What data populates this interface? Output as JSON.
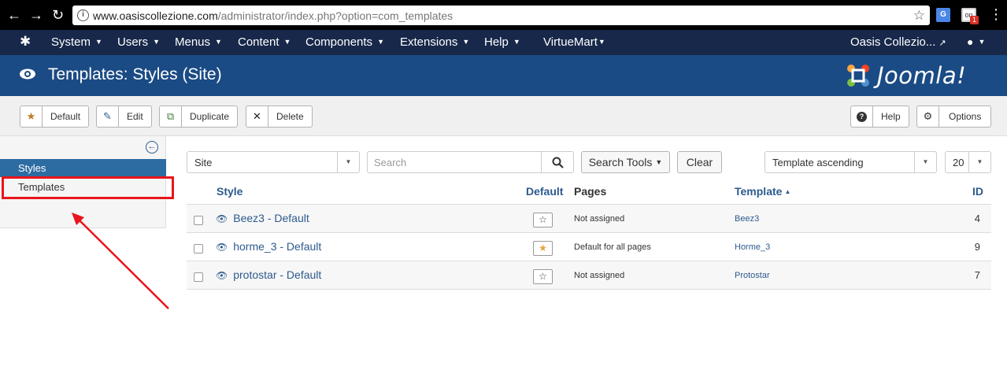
{
  "browser": {
    "url_domain": "www.oasiscollezione.com",
    "url_path": "/administrator/index.php?option=com_templates",
    "ext_badge": "1"
  },
  "navbar": {
    "menus": [
      "System",
      "Users",
      "Menus",
      "Content",
      "Components",
      "Extensions",
      "Help",
      "VirtueMart"
    ],
    "site_name": "Oasis Collezio..."
  },
  "header": {
    "title": "Templates: Styles (Site)",
    "brand": "Joomla!"
  },
  "toolbar": {
    "default_label": "Default",
    "edit_label": "Edit",
    "duplicate_label": "Duplicate",
    "delete_label": "Delete",
    "help_label": "Help",
    "options_label": "Options"
  },
  "sidebar": {
    "items": [
      {
        "label": "Styles",
        "active": true
      },
      {
        "label": "Templates",
        "active": false
      }
    ]
  },
  "filters": {
    "client_value": "Site",
    "search_placeholder": "Search",
    "search_tools_label": "Search Tools",
    "clear_label": "Clear",
    "ordering_value": "Template ascending",
    "limit_value": "20"
  },
  "table": {
    "headers": {
      "style": "Style",
      "default": "Default",
      "pages": "Pages",
      "template": "Template",
      "id": "ID"
    },
    "rows": [
      {
        "style": "Beez3 - Default",
        "home": false,
        "pages": "Not assigned",
        "template": "Beez3",
        "id": "4"
      },
      {
        "style": "horme_3 - Default",
        "home": true,
        "pages": "Default for all pages",
        "template": "Horme_3",
        "id": "9"
      },
      {
        "style": "protostar - Default",
        "home": false,
        "pages": "Not assigned",
        "template": "Protostar",
        "id": "7"
      }
    ]
  },
  "colors": {
    "navbar": "#17284a",
    "header": "#1b4b85",
    "link": "#2d5a8e",
    "active_sidebar": "#2d6ca2",
    "annotation_red": "#e8151b"
  }
}
